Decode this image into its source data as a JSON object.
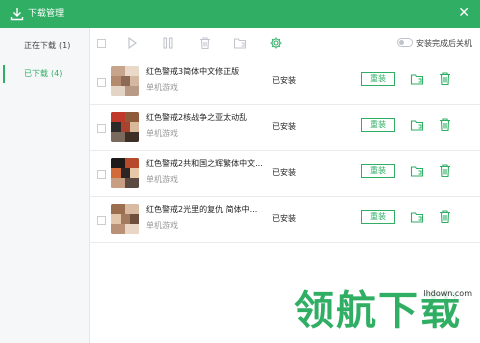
{
  "window": {
    "title": "下载管理",
    "close_glyph": "✕"
  },
  "sidebar": {
    "items": [
      {
        "label": "正在下载",
        "count": "(1)"
      },
      {
        "label": "已下载",
        "count": "(4)"
      }
    ]
  },
  "toolbar": {
    "icons": [
      "select-all-checkbox",
      "play-icon",
      "pause-icon",
      "trash-icon",
      "folder-icon",
      "gear-icon"
    ],
    "shutdown_toggle_label": "安装完成后关机"
  },
  "downloads": [
    {
      "name": "红色警戒3简体中文修正版",
      "type": "单机游戏",
      "status": "已安装",
      "action": "重装"
    },
    {
      "name": "红色警戒2核战争之亚太动乱",
      "type": "单机游戏",
      "status": "已安装",
      "action": "重装"
    },
    {
      "name": "红色警戒2共和国之辉繁体中文...",
      "type": "单机游戏",
      "status": "已安装",
      "action": "重装"
    },
    {
      "name": "红色警戒2光里的复仇 简体中...",
      "type": "单机游戏",
      "status": "已安装",
      "action": "重装"
    }
  ],
  "watermark": {
    "text": "领航下载",
    "site": "lhdown.com"
  },
  "colors": {
    "accent": "#2fae64",
    "icon_gray": "#c2c6cc"
  }
}
